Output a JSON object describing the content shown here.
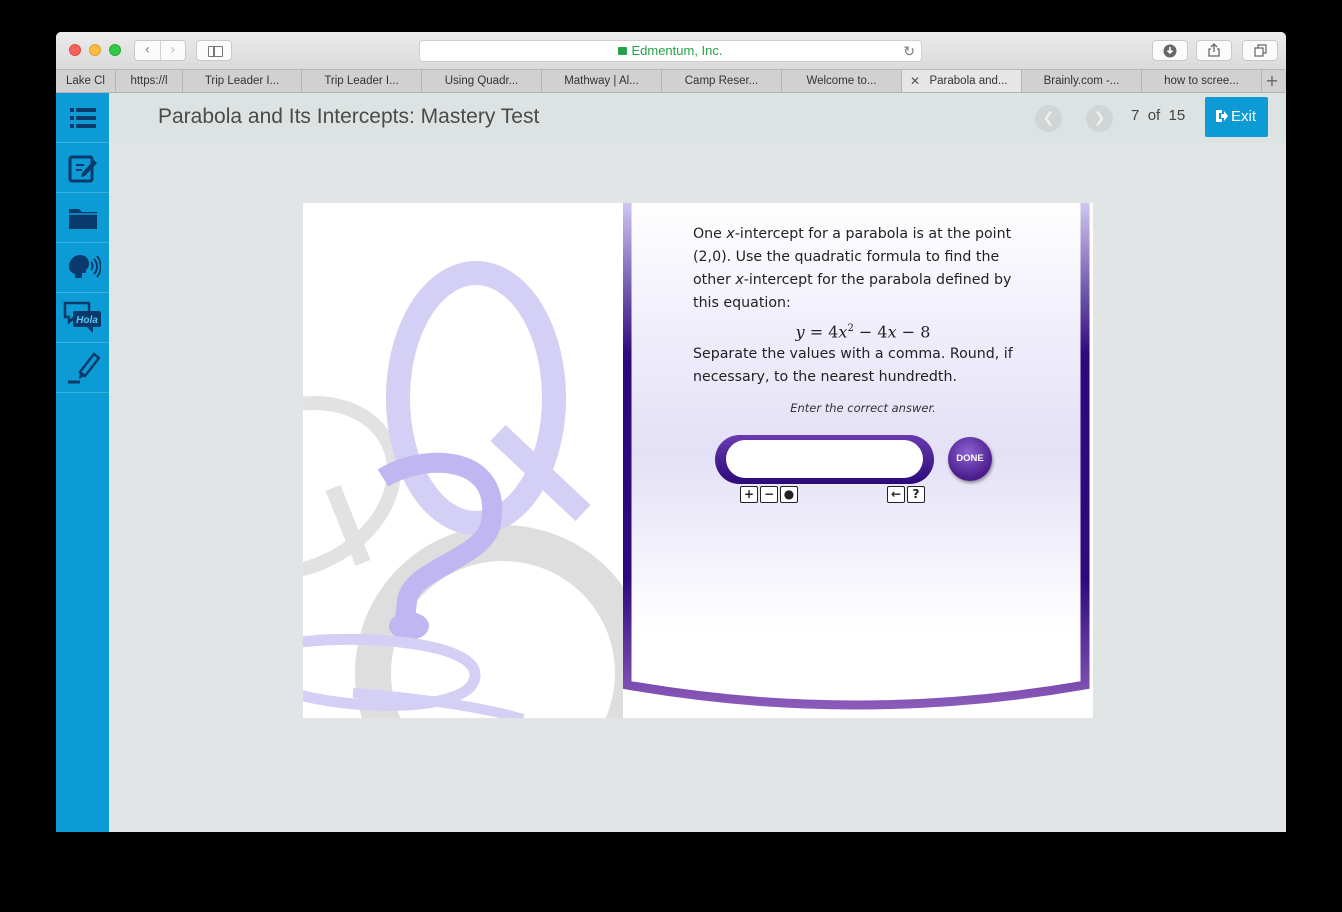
{
  "browser": {
    "url_host": "Edmentum, Inc.",
    "tabs": [
      {
        "label": "Lake Cl",
        "active": false
      },
      {
        "label": "https://l",
        "active": false
      },
      {
        "label": "Trip Leader I...",
        "active": false
      },
      {
        "label": "Trip Leader I...",
        "active": false
      },
      {
        "label": "Using Quadr...",
        "active": false
      },
      {
        "label": "Mathway | Al...",
        "active": false
      },
      {
        "label": "Camp Reser...",
        "active": false
      },
      {
        "label": "Welcome to...",
        "active": false
      },
      {
        "label": "Parabola and...",
        "active": true
      },
      {
        "label": "Brainly.com -...",
        "active": false
      },
      {
        "label": "how to scree...",
        "active": false
      }
    ],
    "new_tab_label": "+"
  },
  "rail": {
    "items": [
      {
        "icon": "list-icon"
      },
      {
        "icon": "notepad-icon"
      },
      {
        "icon": "folder-icon"
      },
      {
        "icon": "text-to-speech-icon"
      },
      {
        "icon": "translate-hola-icon",
        "text": "Hola"
      },
      {
        "icon": "highlighter-icon"
      }
    ]
  },
  "header": {
    "title": "Parabola and Its Intercepts: Mastery Test",
    "current": "7",
    "of_label": "of",
    "total": "15",
    "exit_label": "Exit"
  },
  "question": {
    "text_part1": "One ",
    "x_var": "x",
    "text_part2": "-intercept for a parabola is at the point (2,0). Use the quadratic formula to find the other ",
    "text_part3": "-intercept for the parabola defined by this equation:",
    "equation": {
      "lhs": "y",
      "eq": " = 4",
      "term1_var": "x",
      "exp": "2",
      "rest": " − 4",
      "term2_var": "x",
      "tail": " − 8"
    },
    "text_part4": "Separate the values with a comma. Round, if necessary, to the nearest hundredth.",
    "instruction": "Enter the correct answer.",
    "answer_value": "",
    "done_label": "DONE"
  },
  "colors": {
    "accent": "#0d9bd6",
    "panel_purple": "#3a0c8a",
    "done_purple": "#5b2ca0"
  }
}
